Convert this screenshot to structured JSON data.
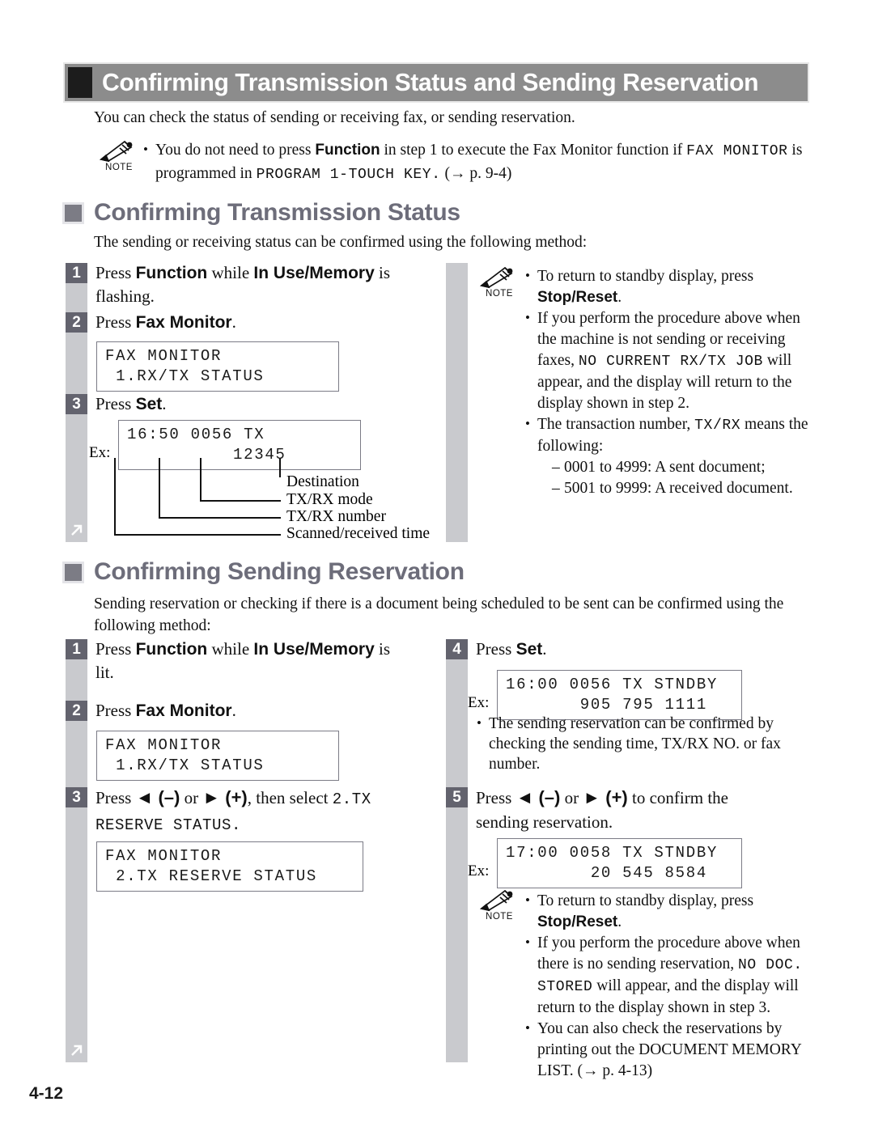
{
  "header": {
    "title": "Confirming Transmission Status and Sending Reservation"
  },
  "intro": {
    "text": "You can check the status of sending or receiving fax, or sending reservation."
  },
  "top_note": {
    "label": "NOTE",
    "line1_a": "You do not need to press ",
    "line1_b": "Function",
    "line1_c": " in step 1 to execute the Fax Monitor function if ",
    "line1_d": "FAX MONITOR",
    "line1_e": " is",
    "line2_a": "programmed in ",
    "line2_b": "PROGRAM 1-TOUCH KEY.",
    "line2_c": " (→ p. 9-4)"
  },
  "section1": {
    "heading": "Confirming Transmission Status",
    "lead": "The sending or receiving status can be confirmed using the following method:",
    "steps": [
      {
        "num": "1",
        "text_a": "Press ",
        "text_b": "Function",
        "text_c": " while ",
        "text_d": "In Use/Memory",
        "text_e": " is",
        "text_f": "flashing."
      },
      {
        "num": "2",
        "text_a": "Press ",
        "text_b": "Fax Monitor",
        "text_c": "."
      },
      {
        "num": "3",
        "text_a": "Press ",
        "text_b": "Set",
        "text_c": "."
      }
    ],
    "lcd1_line1": "FAX MONITOR",
    "lcd1_line2": " 1.RX/TX STATUS",
    "ex_label": "Ex:",
    "lcd2_line1": "16:50 0056 TX",
    "lcd2_line2": "          12345",
    "callouts": [
      "Destination",
      "TX/RX mode",
      "TX/RX number",
      "Scanned/received time"
    ],
    "note": {
      "label": "NOTE",
      "b1_a": "To return to standby display, press",
      "b1_b": "Stop/Reset",
      "b1_c": ".",
      "b2_l1": "If you perform the procedure above when",
      "b2_l2": "the machine is not sending or receiving",
      "b2_l3_a": "faxes, ",
      "b2_l3_b": "NO CURRENT RX/TX JOB",
      "b2_l3_c": " will",
      "b2_l4": "appear, and the display will return to the",
      "b2_l5": "display shown in step 2.",
      "b3_l1_a": "The transaction number, ",
      "b3_l1_b": "TX/RX",
      "b3_l1_c": " means the",
      "b3_l2": "following:",
      "b3_d1": "0001 to 4999: A sent document;",
      "b3_d2": "5001 to 9999: A received document."
    }
  },
  "section2": {
    "heading": "Confirming Sending Reservation",
    "lead_l1": "Sending reservation or checking if there is a document being scheduled to be sent can be confirmed using the",
    "lead_l2": "following method:",
    "left_steps": [
      {
        "num": "1",
        "text_a": "Press ",
        "text_b": "Function",
        "text_c": " while ",
        "text_d": "In Use/Memory",
        "text_e": " is",
        "text_f": "lit."
      },
      {
        "num": "2",
        "text_a": "Press ",
        "text_b": "Fax Monitor",
        "text_c": "."
      },
      {
        "num": "3",
        "text_a": "Press ",
        "text_b": "◄ (–)",
        "text_c": " or ",
        "text_d": "► (+)",
        "text_e": ", then select ",
        "text_f": "2.TX",
        "text_g": "RESERVE STATUS."
      }
    ],
    "lcd_a_line1": "FAX MONITOR",
    "lcd_a_line2": " 1.RX/TX STATUS",
    "lcd_b_line1": "FAX MONITOR",
    "lcd_b_line2": " 2.TX RESERVE STATUS",
    "right_steps": [
      {
        "num": "4",
        "text_a": "Press ",
        "text_b": "Set",
        "text_c": "."
      },
      {
        "num": "5",
        "text_a": "Press ",
        "text_b": "◄ (–)",
        "text_c": " or ",
        "text_d": "► (+)",
        "text_e": " to confirm the",
        "text_f": "sending reservation."
      }
    ],
    "ex_label": "Ex:",
    "lcd_c_line1": "16:00 0056 TX STNDBY",
    "lcd_c_line2": "       905 795 1111",
    "lcd_d_line1": "17:00 0058 TX STNDBY",
    "lcd_d_line2": "        20 545 8584",
    "step4_bullet_l1": "The sending reservation can be confirmed by",
    "step4_bullet_l2": "checking the sending time, TX/RX NO. or fax",
    "step4_bullet_l3": "number.",
    "note": {
      "label": "NOTE",
      "b1_a": "To return to standby display, press",
      "b1_b": "Stop/Reset",
      "b1_c": ".",
      "b2_l1": "If you perform the procedure above when",
      "b2_l2_a": "there is no sending reservation, ",
      "b2_l2_b": "NO DOC.",
      "b2_l3_a": "STORED",
      "b2_l3_b": " will appear, and the display will",
      "b2_l4": "return to the display shown in step 3.",
      "b3_l1": "You can also check the reservations by",
      "b3_l2": "printing out the DOCUMENT MEMORY",
      "b3_l3": "LIST. (→ p. 4-13)"
    }
  },
  "footer": {
    "page": "4-12"
  },
  "colors": {
    "title_bar": "#8c8c8c",
    "heading": "#6d6d7a",
    "rail": "#c9cace",
    "step_box": "#63636e"
  }
}
